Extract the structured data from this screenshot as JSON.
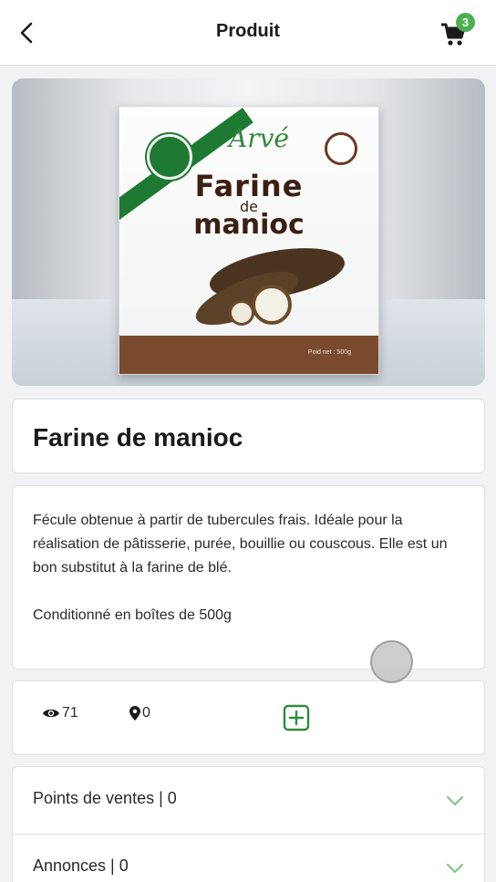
{
  "header": {
    "title": "Produit",
    "back_icon": "chevron-left-icon",
    "cart_icon": "cart-icon",
    "cart_count": "3",
    "accent_color": "#4caf50"
  },
  "product": {
    "image": {
      "brand": "Arvé",
      "line1": "Farine",
      "line2": "de",
      "line3": "manioc",
      "net_weight": "Poid net : 500g"
    },
    "title": "Farine de manioc",
    "description_p1": "Fécule obtenue à partir de tubercules frais. Idéale pour la réalisation de pâtisserie, purée, bouillie ou couscous. Elle est un bon substitut à la farine de blé.",
    "description_p2": "Conditionné en boîtes de 500g"
  },
  "stats": {
    "views": "71",
    "views_icon": "eye-icon",
    "locations": "0",
    "locations_icon": "map-marker-icon",
    "add_icon": "plus-square-icon"
  },
  "accordion": {
    "items": [
      {
        "label": "Points de ventes | 0",
        "icon": "chevron-down-icon"
      },
      {
        "label": "Annonces | 0",
        "icon": "chevron-down-icon"
      }
    ]
  }
}
